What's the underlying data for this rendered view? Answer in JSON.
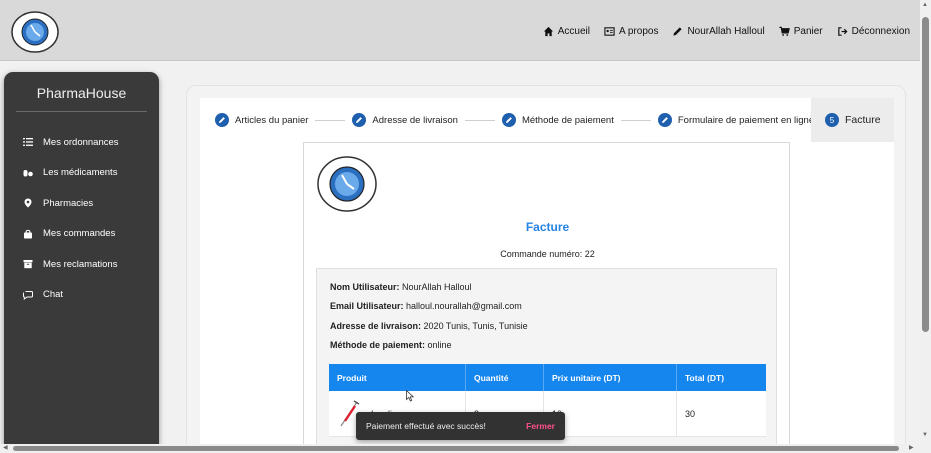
{
  "nav": {
    "items": [
      {
        "label": "Accueil",
        "icon": "home-icon"
      },
      {
        "label": "A propos",
        "icon": "id-card-icon"
      },
      {
        "label": "NourAllah Halloul",
        "icon": "pencil-icon"
      },
      {
        "label": "Panier",
        "icon": "cart-icon"
      },
      {
        "label": "Déconnexion",
        "icon": "logout-icon"
      }
    ]
  },
  "sidebar": {
    "title": "PharmaHouse",
    "items": [
      {
        "label": "Mes ordonnances",
        "icon": "list-icon"
      },
      {
        "label": "Les médicaments",
        "icon": "pills-icon"
      },
      {
        "label": "Pharmacies",
        "icon": "map-pin-icon"
      },
      {
        "label": "Mes commandes",
        "icon": "shopping-bag-icon"
      },
      {
        "label": "Mes reclamations",
        "icon": "archive-icon"
      },
      {
        "label": "Chat",
        "icon": "chat-icon"
      }
    ]
  },
  "stepper": {
    "steps": [
      {
        "label": "Articles du panier"
      },
      {
        "label": "Adresse de livraison"
      },
      {
        "label": "Méthode de paiement"
      },
      {
        "label": "Formulaire de paiement en ligne"
      }
    ],
    "active": {
      "number": "5",
      "label": "Facture"
    }
  },
  "invoice": {
    "title": "Facture",
    "order_number": "Commande numéro: 22",
    "fields": [
      {
        "label": "Nom Utilisateur:",
        "value": " NourAllah Halloul"
      },
      {
        "label": "Email Utilisateur:",
        "value": " halloul.nourallah@gmail.com"
      },
      {
        "label": "Adresse de livraison:",
        "value": " 2020 Tunis, Tunis, Tunisie"
      },
      {
        "label": "Méthode de paiement:",
        "value": " online"
      }
    ],
    "table": {
      "headers": [
        "Produit",
        "Quantité",
        "Prix unitaire (DT)",
        "Total (DT)"
      ],
      "rows": [
        {
          "product": "Insuline",
          "quantity": "3",
          "unit_price": "10",
          "total": "30"
        }
      ]
    }
  },
  "snackbar": {
    "message": "Paiement effectué avec succès!",
    "action": "Fermer"
  },
  "colors": {
    "accent": "#1686ef",
    "step_blue": "#1e5fae",
    "sidebar_bg": "#3a3a3a",
    "snackbar_action": "#ff4f8a"
  }
}
